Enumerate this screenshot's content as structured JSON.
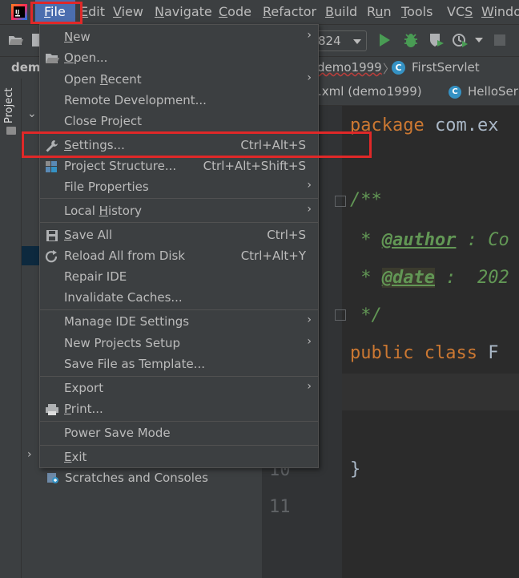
{
  "menubar": {
    "items": [
      {
        "key": "file",
        "label": "File",
        "mnemonic": "F"
      },
      {
        "key": "edit",
        "label": "Edit",
        "mnemonic": "E"
      },
      {
        "key": "view",
        "label": "View",
        "mnemonic": "V"
      },
      {
        "key": "navigate",
        "label": "Navigate",
        "mnemonic": "N"
      },
      {
        "key": "code",
        "label": "Code",
        "mnemonic": "C"
      },
      {
        "key": "refactor",
        "label": "Refactor",
        "mnemonic": "R"
      },
      {
        "key": "build",
        "label": "Build",
        "mnemonic": "B"
      },
      {
        "key": "run",
        "label": "Run",
        "mnemonic": "u"
      },
      {
        "key": "tools",
        "label": "Tools",
        "mnemonic": "T"
      },
      {
        "key": "vcs",
        "label": "VCS",
        "mnemonic": "S"
      },
      {
        "key": "window",
        "label": "Windo",
        "mnemonic": "W"
      }
    ]
  },
  "toolbar": {
    "run_config": "824"
  },
  "breadcrumb": {
    "project_short": "dem",
    "project": "demo1999",
    "separator": "〉",
    "class_icon": "C",
    "class": "FirstServlet"
  },
  "tool_stripe": {
    "project_label": "Project"
  },
  "project_pane": {
    "scratches": "Scratches and Consoles"
  },
  "editor_tabs": {
    "pom": ".xml (demo1999)",
    "hello_icon": "C",
    "hello": "HelloSer"
  },
  "gutter": {
    "line_10": "10",
    "line_11": "11"
  },
  "code": {
    "pkg_kw": "package",
    "pkg_name": " com.ex",
    "doc_open": "/**",
    "author_star": " * ",
    "author_tag": "@author",
    "author_rest": " : Co",
    "date_star": " * ",
    "date_tag": "@date",
    "date_rest": " :  202",
    "doc_close": " */",
    "class_kw": "public class",
    "class_name": " F",
    "brace": "}"
  },
  "file_menu": {
    "new": {
      "label": "New"
    },
    "open": {
      "label": "Open..."
    },
    "open_recent": {
      "label": "Open Recent"
    },
    "remote_dev": {
      "label": "Remote Development..."
    },
    "close_project": {
      "label": "Close Project"
    },
    "settings": {
      "label": "Settings...",
      "shortcut": "Ctrl+Alt+S"
    },
    "project_structure": {
      "label": "Project Structure...",
      "shortcut": "Ctrl+Alt+Shift+S"
    },
    "file_properties": {
      "label": "File Properties"
    },
    "local_history": {
      "label": "Local History"
    },
    "save_all": {
      "label": "Save All",
      "shortcut": "Ctrl+S"
    },
    "reload": {
      "label": "Reload All from Disk",
      "shortcut": "Ctrl+Alt+Y"
    },
    "repair": {
      "label": "Repair IDE"
    },
    "invalidate": {
      "label": "Invalidate Caches..."
    },
    "manage_settings": {
      "label": "Manage IDE Settings"
    },
    "new_projects_setup": {
      "label": "New Projects Setup"
    },
    "save_template": {
      "label": "Save File as Template..."
    },
    "export": {
      "label": "Export"
    },
    "print": {
      "label": "Print..."
    },
    "power_save": {
      "label": "Power Save Mode"
    },
    "exit": {
      "label": "Exit"
    }
  },
  "colors": {
    "highlight_box": "#e02828",
    "menu_active": "#4b6eaf",
    "keyword": "#cc7832",
    "comment": "#629755"
  }
}
